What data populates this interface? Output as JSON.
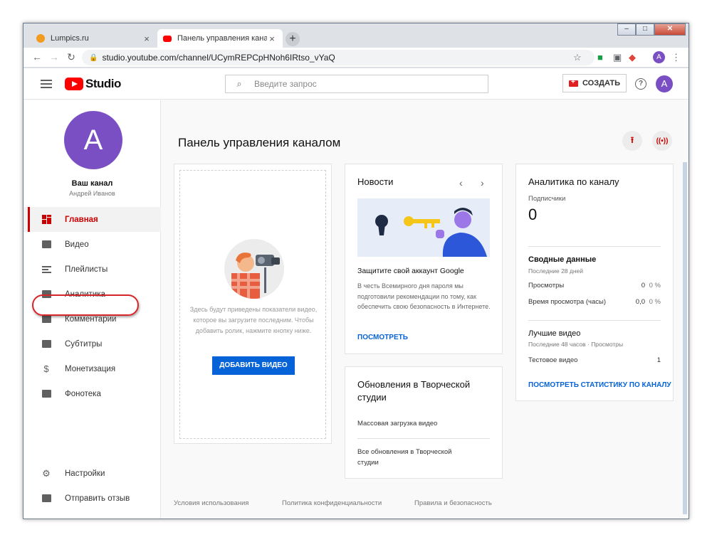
{
  "browser": {
    "tabs": [
      {
        "title": "Lumpics.ru",
        "favicon_color": "#f29b1f"
      },
      {
        "title": "Панель управления каналом - Y",
        "favicon_color": "#ff0000"
      }
    ],
    "new_tab": "+",
    "url": "studio.youtube.com/channel/UCymREPCpHNoh6IRtso_vYaQ",
    "avatar_letter": "A"
  },
  "header": {
    "logo_text": "Studio",
    "search_placeholder": "Введите запрос",
    "create_label": "СОЗДАТЬ",
    "avatar_letter": "A"
  },
  "sidebar": {
    "avatar_letter": "A",
    "channel_name": "Ваш канал",
    "channel_owner": "Андрей Иванов",
    "items": [
      {
        "label": "Главная",
        "icon": "dashboard-icon",
        "active": true
      },
      {
        "label": "Видео",
        "icon": "video-icon"
      },
      {
        "label": "Плейлисты",
        "icon": "playlist-icon"
      },
      {
        "label": "Аналитика",
        "icon": "analytics-icon",
        "highlighted": true
      },
      {
        "label": "Комментарии",
        "icon": "comments-icon"
      },
      {
        "label": "Субтитры",
        "icon": "subtitles-icon"
      },
      {
        "label": "Монетизация",
        "icon": "dollar-icon"
      },
      {
        "label": "Фонотека",
        "icon": "audio-library-icon"
      }
    ],
    "bottom_items": [
      {
        "label": "Настройки",
        "icon": "gear-icon"
      },
      {
        "label": "Отправить отзыв",
        "icon": "feedback-icon"
      }
    ],
    "highlight_color": "#d6262a"
  },
  "main": {
    "title": "Панель управления каналом",
    "upload_card": {
      "text": "Здесь будут приведены показатели видео, которое вы загрузите последним. Чтобы добавить ролик, нажмите кнопку ниже.",
      "button": "ДОБАВИТЬ ВИДЕО"
    },
    "news_card": {
      "heading": "Новости",
      "title": "Защитите свой аккаунт Google",
      "body": "В честь Всемирного дня пароля мы подготовили рекомендации по тому, как обеспечить свою безопасность в Интернете.",
      "link": "ПОСМОТРЕТЬ"
    },
    "updates_card": {
      "heading": "Обновления в Творческой студии",
      "items": [
        "Массовая загрузка видео",
        "Все обновления в Творческой студии"
      ]
    },
    "analytics_card": {
      "heading": "Аналитика по каналу",
      "subscribers_label": "Подписчики",
      "subscribers_value": "0",
      "summary_heading": "Сводные данные",
      "summary_period": "Последние 28 дней",
      "rows": [
        {
          "label": "Просмотры",
          "value": "0",
          "pct": "0 %"
        },
        {
          "label": "Время просмотра (часы)",
          "value": "0,0",
          "pct": "0 %"
        }
      ],
      "top_heading": "Лучшие видео",
      "top_period": "Последние 48 часов · Просмотры",
      "top_video": {
        "title": "Тестовое видео",
        "views": "1"
      },
      "link": "ПОСМОТРЕТЬ СТАТИСТИКУ ПО КАНАЛУ"
    },
    "footer": [
      "Условия использования",
      "Политика конфиденциальности",
      "Правила и безопасность"
    ]
  },
  "colors": {
    "accent_blue": "#0663d7",
    "brand_red": "#ff0000",
    "avatar_purple": "#7b4fc4"
  }
}
